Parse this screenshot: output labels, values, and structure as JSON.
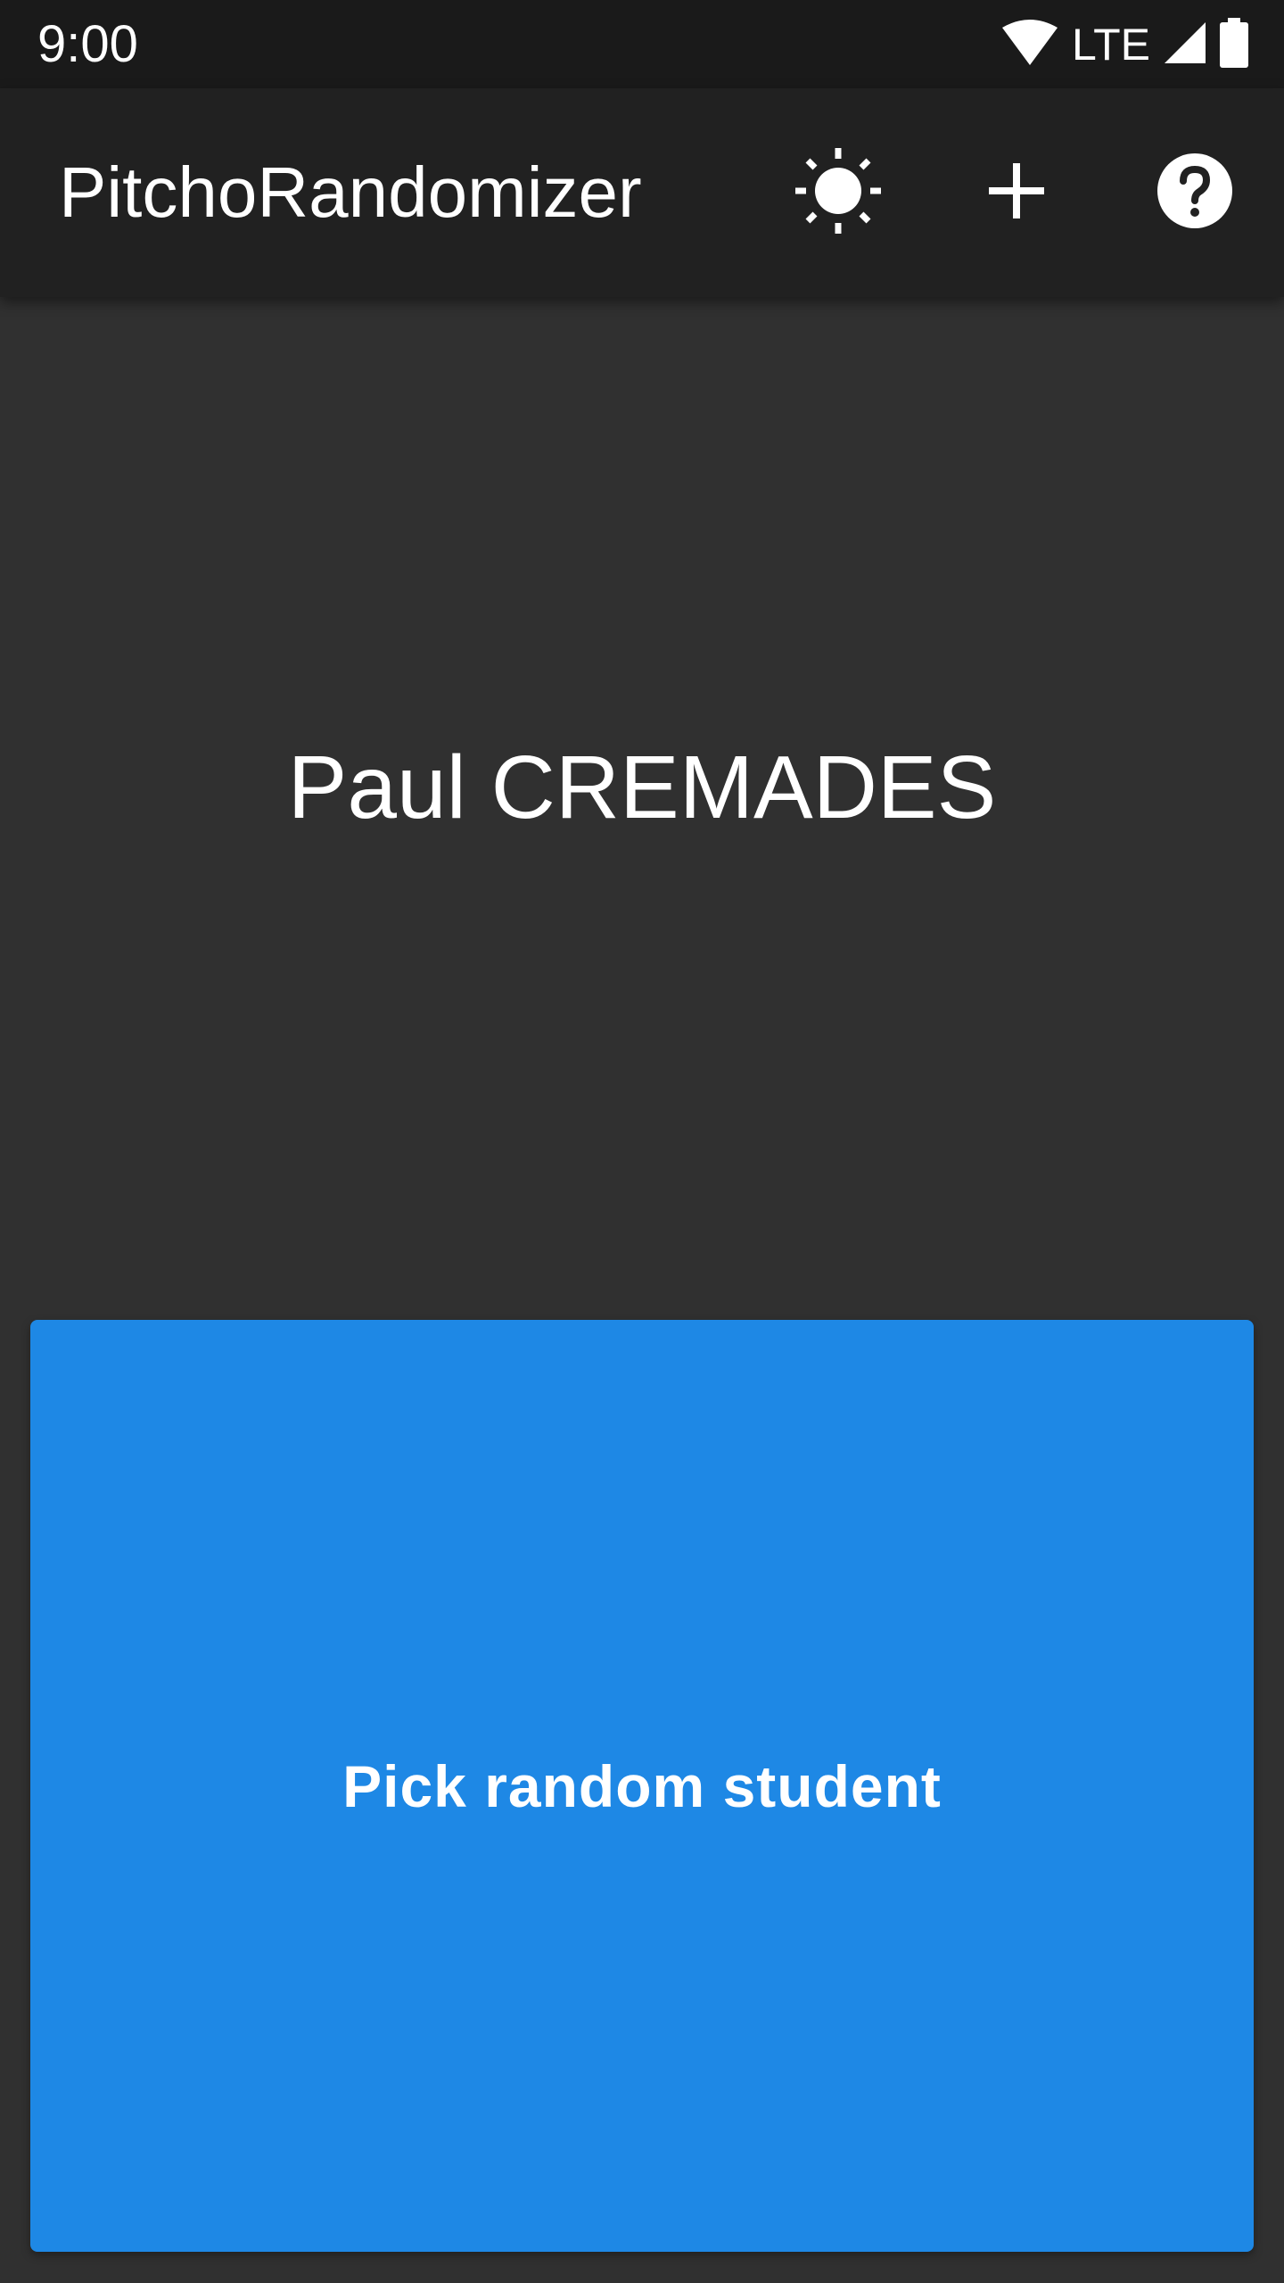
{
  "status_bar": {
    "time": "9:00",
    "network": "LTE",
    "icons": [
      "wifi-icon",
      "cell-signal-icon",
      "battery-icon"
    ]
  },
  "app_bar": {
    "title": "PitchoRandomizer",
    "actions": [
      {
        "name": "theme-toggle-button",
        "icon": "brightness-icon"
      },
      {
        "name": "add-button",
        "icon": "plus-icon"
      },
      {
        "name": "help-button",
        "icon": "help-circle-icon"
      }
    ]
  },
  "main": {
    "selected_student": "Paul CREMADES",
    "pick_button_label": "Pick random student"
  },
  "colors": {
    "status_bar_bg": "#1a1a1a",
    "app_bar_bg": "#212121",
    "background": "#303030",
    "accent": "#1e88e5",
    "text": "#ffffff"
  }
}
